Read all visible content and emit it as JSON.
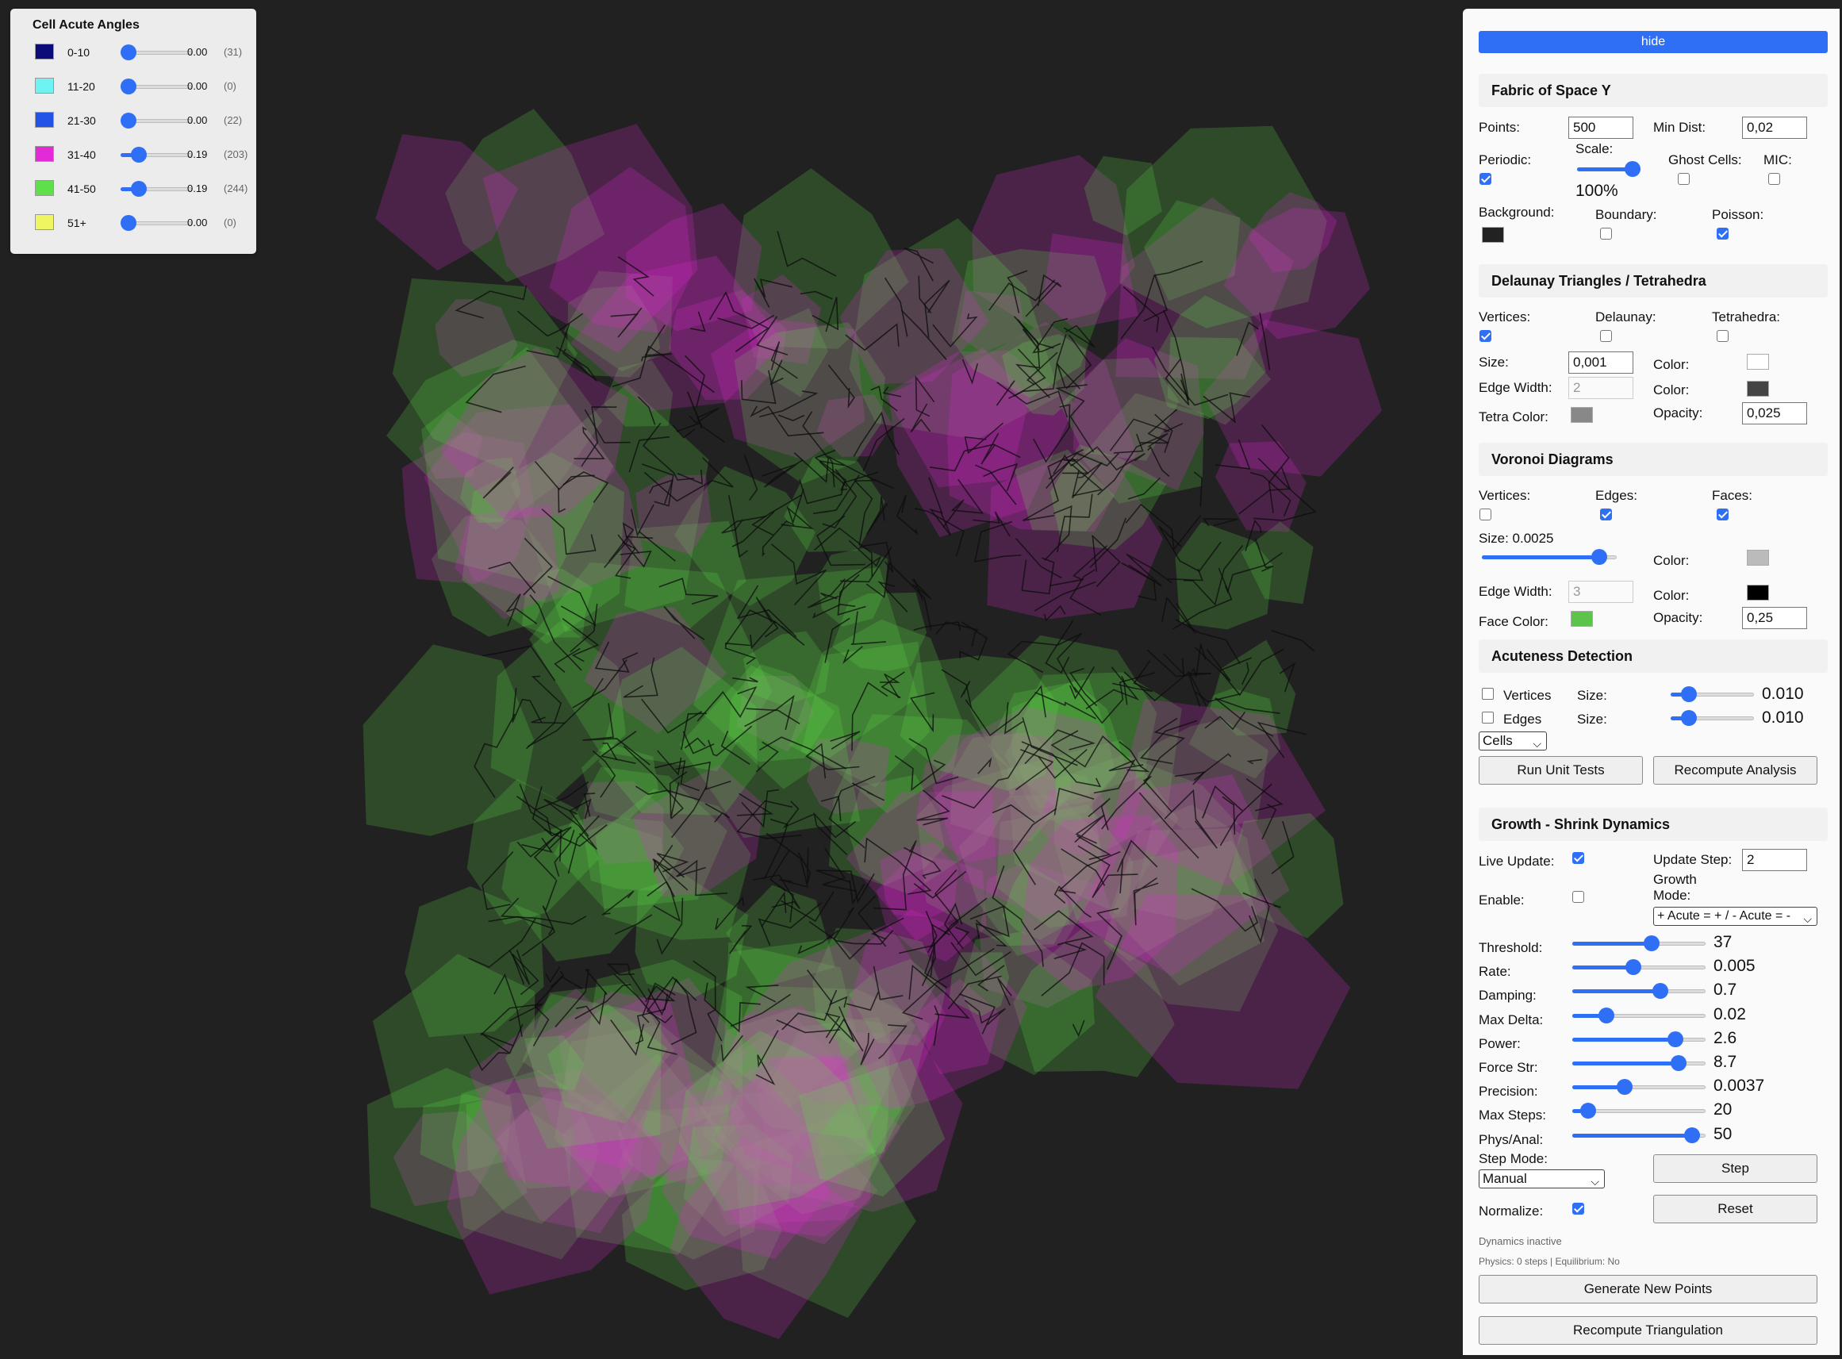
{
  "legend": {
    "title": "Cell Acute Angles",
    "rows": [
      {
        "range": "0-10",
        "value": "0.00",
        "count": "(31)",
        "color": "#0b0b7a",
        "level": 0.0
      },
      {
        "range": "11-20",
        "value": "0.00",
        "count": "(0)",
        "color": "#6ff2f2",
        "level": 0.0
      },
      {
        "range": "21-30",
        "value": "0.00",
        "count": "(22)",
        "color": "#2453e8",
        "level": 0.0
      },
      {
        "range": "31-40",
        "value": "0.19",
        "count": "(203)",
        "color": "#e22bd6",
        "level": 0.19
      },
      {
        "range": "41-50",
        "value": "0.19",
        "count": "(244)",
        "color": "#5fe04a",
        "level": 0.19
      },
      {
        "range": "51+",
        "value": "0.00",
        "count": "(0)",
        "color": "#eef560",
        "level": 0.0
      }
    ]
  },
  "panel": {
    "hide_label": "hide",
    "fabric": {
      "title": "Fabric of Space Y",
      "points_label": "Points:",
      "points_value": "500",
      "mindist_label": "Min Dist:",
      "mindist_value": "0,02",
      "periodic_label": "Periodic:",
      "periodic": true,
      "scale_label": "Scale:",
      "scale_value": "100%",
      "scale_level": 1.0,
      "ghost_label": "Ghost Cells:",
      "ghost": false,
      "mic_label": "MIC:",
      "mic": false,
      "background_label": "Background:",
      "background_color": "#222222",
      "boundary_label": "Boundary:",
      "boundary": false,
      "poisson_label": "Poisson:",
      "poisson": true
    },
    "delaunay": {
      "title": "Delaunay Triangles / Tetrahedra",
      "vertices_label": "Vertices:",
      "vertices": true,
      "delaunay_label": "Delaunay:",
      "delaunay": false,
      "tetra_label": "Tetrahedra:",
      "tetra": false,
      "size_label": "Size:",
      "size_value": "0,001",
      "color_label": "Color:",
      "vertex_color": "#ffffff",
      "edge_width_label": "Edge Width:",
      "edge_width_value": "2",
      "color2_label": "Color:",
      "edge_color": "#444444",
      "tetra_color_label": "Tetra Color:",
      "tetra_color": "#888888",
      "opacity_label": "Opacity:",
      "opacity_value": "0,025"
    },
    "voronoi": {
      "title": "Voronoi Diagrams",
      "vertices_label": "Vertices:",
      "vertices": false,
      "edges_label": "Edges:",
      "edges": true,
      "faces_label": "Faces:",
      "faces": true,
      "size_label": "Size: 0.0025",
      "size_level": 0.92,
      "color_label": "Color:",
      "vertex_color": "#bbbbbb",
      "edge_width_label": "Edge Width:",
      "edge_width_value": "3",
      "color2_label": "Color:",
      "edge_color": "#000000",
      "face_color_label": "Face Color:",
      "face_color": "#5cc44a",
      "opacity_label": "Opacity:",
      "opacity_value": "0,25"
    },
    "acute": {
      "title": "Acuteness Detection",
      "vertices_label": "Vertices",
      "vertices": false,
      "edges_label": "Edges",
      "edges": false,
      "size_label": "Size:",
      "size1_value": "0.010",
      "size1_level": 0.15,
      "size2_label": "Size:",
      "size2_value": "0.010",
      "size2_level": 0.15,
      "mode_select": "Cells",
      "run_tests": "Run Unit Tests",
      "recompute_analysis": "Recompute Analysis"
    },
    "growth": {
      "title": "Growth - Shrink Dynamics",
      "live_label": "Live Update:",
      "live": true,
      "update_step_label": "Update Step:",
      "update_step_value": "2",
      "growth_mode_label1": "Growth",
      "growth_mode_label2": "Mode:",
      "enable_label": "Enable:",
      "enable": false,
      "growth_mode_value": "+ Acute = + / - Acute = -",
      "params": [
        {
          "label": "Threshold:",
          "value": "37",
          "level": 0.61
        },
        {
          "label": "Rate:",
          "value": "0.005",
          "level": 0.45
        },
        {
          "label": "Damping:",
          "value": "0.7",
          "level": 0.68
        },
        {
          "label": "Max Delta:",
          "value": "0.02",
          "level": 0.22
        },
        {
          "label": "Power:",
          "value": "2.6",
          "level": 0.81
        },
        {
          "label": "Force Str:",
          "value": "8.7",
          "level": 0.84
        },
        {
          "label": "Precision:",
          "value": "0.0037",
          "level": 0.38
        },
        {
          "label": "Max Steps:",
          "value": "20",
          "level": 0.07
        },
        {
          "label": "Phys/Anal:",
          "value": "50",
          "level": 0.95
        }
      ],
      "step_mode_label": "Step Mode:",
      "step_mode_value": "Manual",
      "step_button": "Step",
      "normalize_label": "Normalize:",
      "normalize": true,
      "reset_button": "Reset",
      "status": "Dynamics inactive",
      "physics_status": "Physics: 0 steps | Equilibrium: No",
      "generate_button": "Generate New Points",
      "recompute_button": "Recompute Triangulation"
    }
  }
}
